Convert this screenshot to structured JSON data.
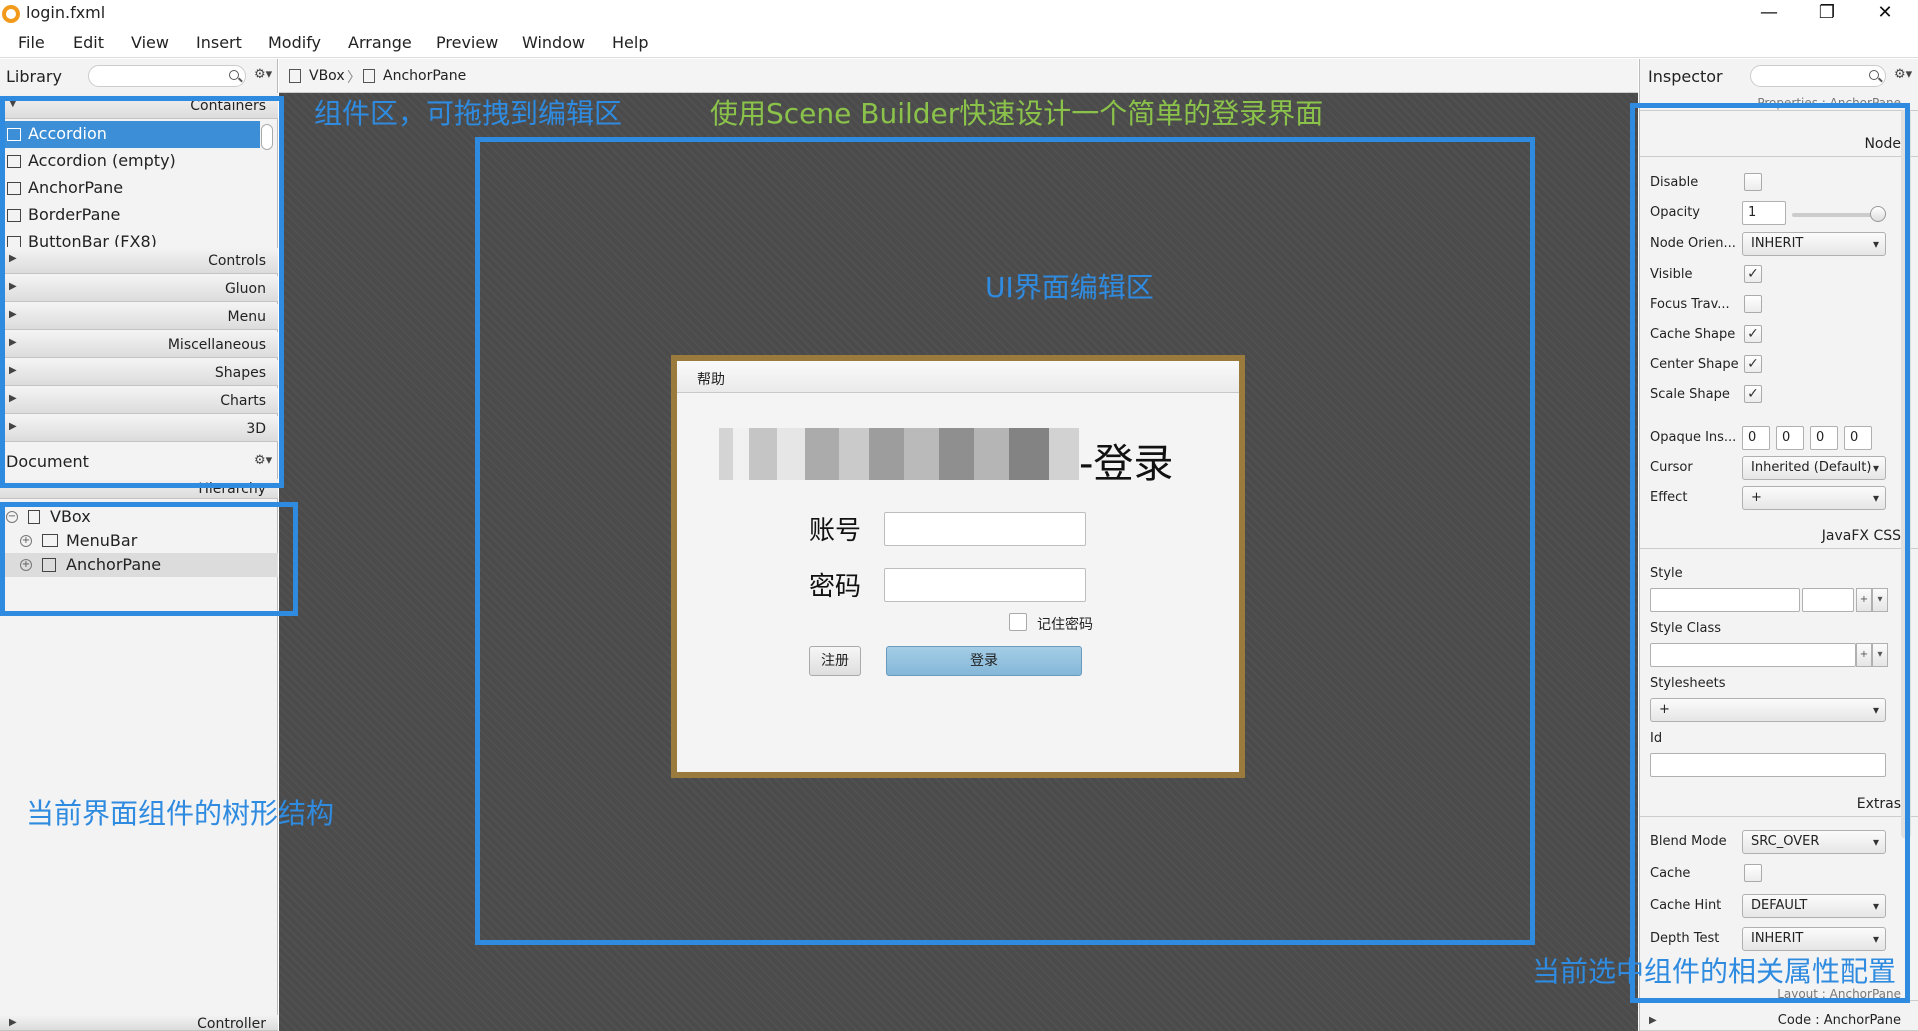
{
  "window": {
    "title": "login.fxml",
    "minimize": "—",
    "maximize": "❐",
    "close": "✕"
  },
  "menubar": [
    "File",
    "Edit",
    "View",
    "Insert",
    "Modify",
    "Arrange",
    "Preview",
    "Window",
    "Help"
  ],
  "library": {
    "title": "Library",
    "containers_header": "Containers",
    "items": [
      "Accordion",
      "Accordion  (empty)",
      "AnchorPane",
      "BorderPane",
      "ButtonBar  (FX8)"
    ],
    "sections": [
      "Controls",
      "Gluon",
      "Menu",
      "Miscellaneous",
      "Shapes",
      "Charts",
      "3D"
    ]
  },
  "document": {
    "title": "Document",
    "hierarchy_header": "Hierarchy",
    "tree": [
      "VBox",
      "MenuBar",
      "AnchorPane"
    ],
    "controller_header": "Controller"
  },
  "breadcrumb": [
    "VBox",
    "AnchorPane"
  ],
  "dialog": {
    "menu": "帮助",
    "title_suffix": "-登录",
    "account_label": "账号",
    "password_label": "密码",
    "remember_label": "记住密码",
    "register_button": "注册",
    "login_button": "登录"
  },
  "inspector": {
    "title": "Inspector",
    "properties_header": "Properties : AnchorPane",
    "node_header": "Node",
    "disable_label": "Disable",
    "opacity_label": "Opacity",
    "opacity_value": "1",
    "opacity_level": 1.0,
    "node_orientation_label": "Node Orien...",
    "node_orientation_value": "INHERIT",
    "visible_label": "Visible",
    "focus_label": "Focus Trav...",
    "cache_shape_label": "Cache Shape",
    "center_shape_label": "Center Shape",
    "scale_shape_label": "Scale Shape",
    "opaque_label": "Opaque Ins...",
    "opaque_values": [
      "0",
      "0",
      "0",
      "0"
    ],
    "cursor_label": "Cursor",
    "cursor_value": "Inherited (Default)",
    "effect_label": "Effect",
    "effect_value": "+",
    "css_header": "JavaFX CSS",
    "style_label": "Style",
    "style_class_label": "Style Class",
    "stylesheets_label": "Stylesheets",
    "stylesheets_add": "+",
    "id_label": "Id",
    "extras_header": "Extras",
    "blend_mode_label": "Blend Mode",
    "blend_mode_value": "SRC_OVER",
    "cache_label": "Cache",
    "cache_hint_label": "Cache Hint",
    "cache_hint_value": "DEFAULT",
    "depth_test_label": "Depth Test",
    "depth_test_value": "INHERIT",
    "layout_header": "Layout : AnchorPane",
    "code_header": "Code : AnchorPane"
  },
  "annotations": {
    "library_note": "组件区，可拖拽到编辑区",
    "title_note": "使用Scene Builder快速设计一个简单的登录界面",
    "editor_note": "UI界面编辑区",
    "tree_note": "当前界面组件的树形结构",
    "props_note": "当前选中组件的相关属性配置"
  },
  "colors": {
    "annotation_blue": "#2f8be0",
    "annotation_green": "#8bc34a",
    "selection": "#3c8fd6",
    "login_button": "#8fbfdd"
  }
}
